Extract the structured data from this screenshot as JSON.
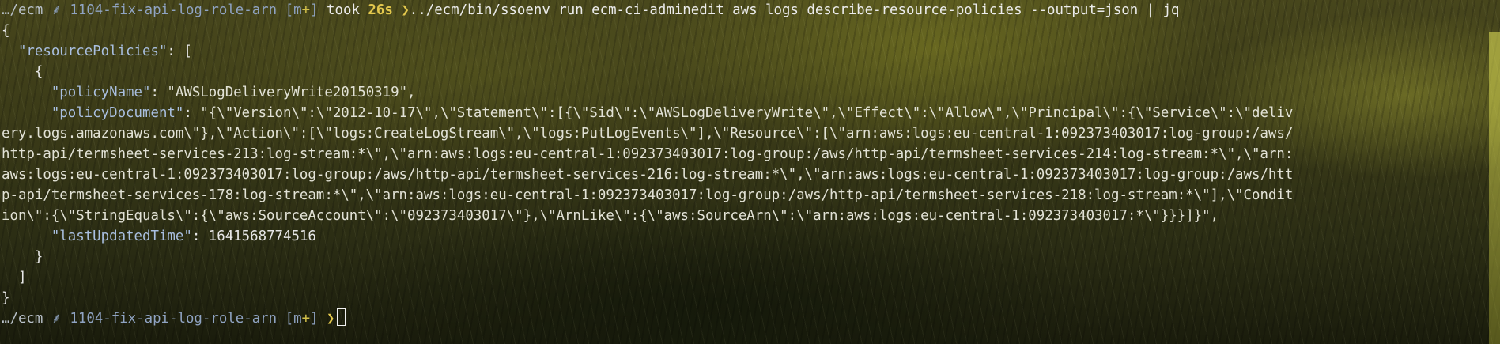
{
  "prompt": {
    "path": "…/ecm",
    "branch_icon": "git-branch-icon",
    "branch_glyph": "⸙",
    "branch": "1104-fix-api-log-role-arn",
    "status_open": "[m",
    "status_plus": "+",
    "status_close": "]",
    "took_label": "took",
    "took_value": "26s",
    "chevron": "❯",
    "command": "../ecm/bin/ssoenv run ecm-ci-adminedit aws logs describe-resource-policies --output=json | jq"
  },
  "output": {
    "open_brace": "{",
    "resource_policies_key": "\"resourcePolicies\"",
    "resource_policies_sep": ": [",
    "item_open": "{",
    "policy_name_key": "\"policyName\"",
    "policy_name_sep": ": ",
    "policy_name_value": "\"AWSLogDeliveryWrite20150319\",",
    "policy_document_key": "\"policyDocument\"",
    "policy_document_sep": ": ",
    "policy_document_lines": [
      "\"{\\\"Version\\\":\\\"2012-10-17\\\",\\\"Statement\\\":[{\\\"Sid\\\":\\\"AWSLogDeliveryWrite\\\",\\\"Effect\\\":\\\"Allow\\\",\\\"Principal\\\":{\\\"Service\\\":\\\"deliv",
      "ery.logs.amazonaws.com\\\"},\\\"Action\\\":[\\\"logs:CreateLogStream\\\",\\\"logs:PutLogEvents\\\"],\\\"Resource\\\":[\\\"arn:aws:logs:eu-central-1:092373403017:log-group:/aws/",
      "http-api/termsheet-services-213:log-stream:*\\\",\\\"arn:aws:logs:eu-central-1:092373403017:log-group:/aws/http-api/termsheet-services-214:log-stream:*\\\",\\\"arn:",
      "aws:logs:eu-central-1:092373403017:log-group:/aws/http-api/termsheet-services-216:log-stream:*\\\",\\\"arn:aws:logs:eu-central-1:092373403017:log-group:/aws/htt",
      "p-api/termsheet-services-178:log-stream:*\\\",\\\"arn:aws:logs:eu-central-1:092373403017:log-group:/aws/http-api/termsheet-services-218:log-stream:*\\\"],\\\"Condit",
      "ion\\\":{\\\"StringEquals\\\":{\\\"aws:SourceAccount\\\":\\\"092373403017\\\"},\\\"ArnLike\\\":{\\\"aws:SourceArn\\\":\\\"arn:aws:logs:eu-central-1:092373403017:*\\\"}}}]}\","
    ],
    "last_updated_key": "\"lastUpdatedTime\"",
    "last_updated_sep": ": ",
    "last_updated_value": "1641568774516",
    "item_close": "}",
    "array_close": "]",
    "close_brace": "}"
  },
  "next_prompt": {
    "path": "…/ecm",
    "branch_icon": "git-branch-icon",
    "branch_glyph": "⸙",
    "branch": "1104-fix-api-log-role-arn",
    "status_open": "[m",
    "status_plus": "+",
    "status_close": "]",
    "chevron": "❯",
    "cursor_icon": "block-cursor-icon"
  },
  "colors": {
    "json_key": "#a9bfe0",
    "branch": "#8fa3c2",
    "duration": "#e3c84d",
    "background": "#3b3b18"
  }
}
